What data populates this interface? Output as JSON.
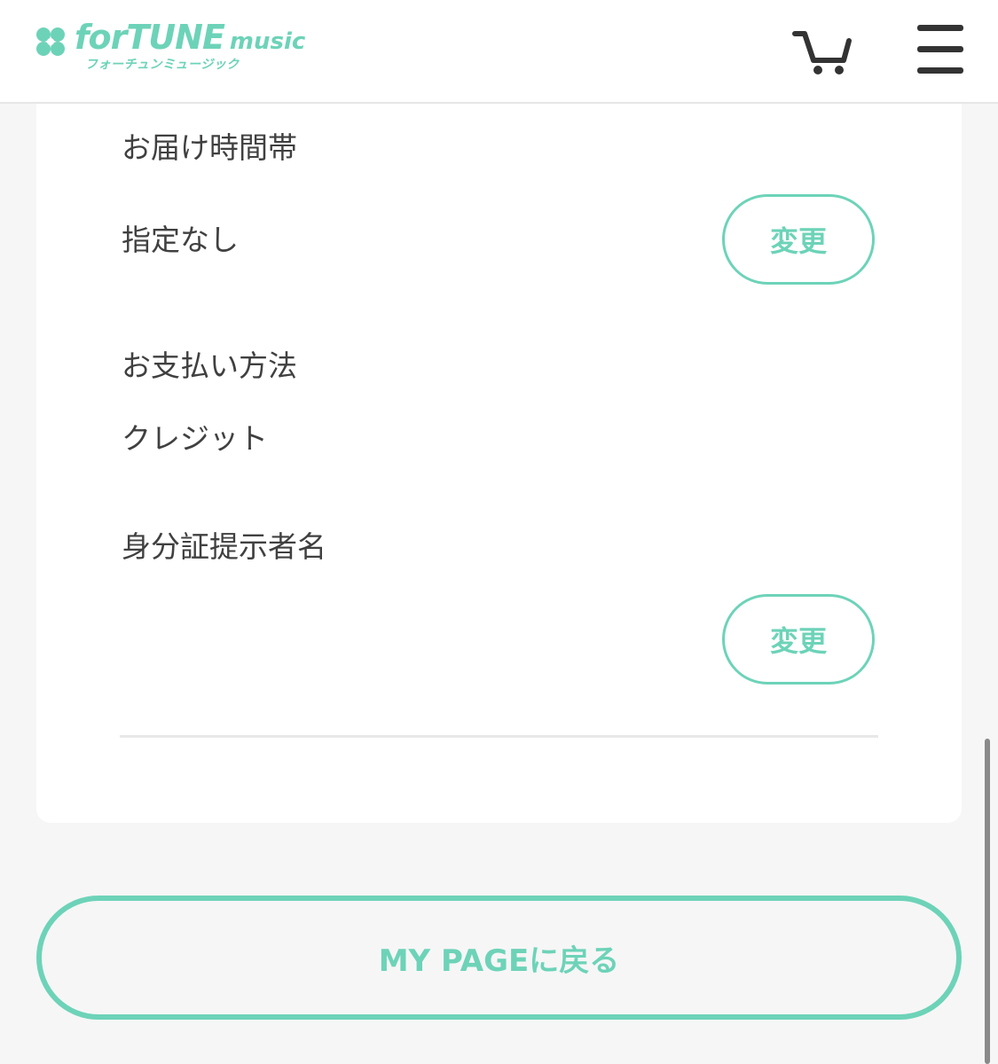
{
  "header": {
    "logo_main": "forTUNE",
    "logo_main_small": "music",
    "logo_sub": "フォーチュンミュージック",
    "cart_icon": "cart-icon",
    "menu_icon": "hamburger-menu-icon"
  },
  "order": {
    "delivery_time_label": "お届け時間帯",
    "delivery_time_value": "指定なし",
    "delivery_change_label": "変更",
    "payment_label": "お支払い方法",
    "payment_value": "クレジット",
    "id_name_label": "身分証提示者名",
    "id_name_value": "",
    "id_change_label": "変更"
  },
  "footer": {
    "mypage_button_label": "MY PAGEに戻る"
  },
  "colors": {
    "accent": "#6dd3b8",
    "text": "#404040",
    "background": "#f6f6f6",
    "card": "#ffffff"
  }
}
